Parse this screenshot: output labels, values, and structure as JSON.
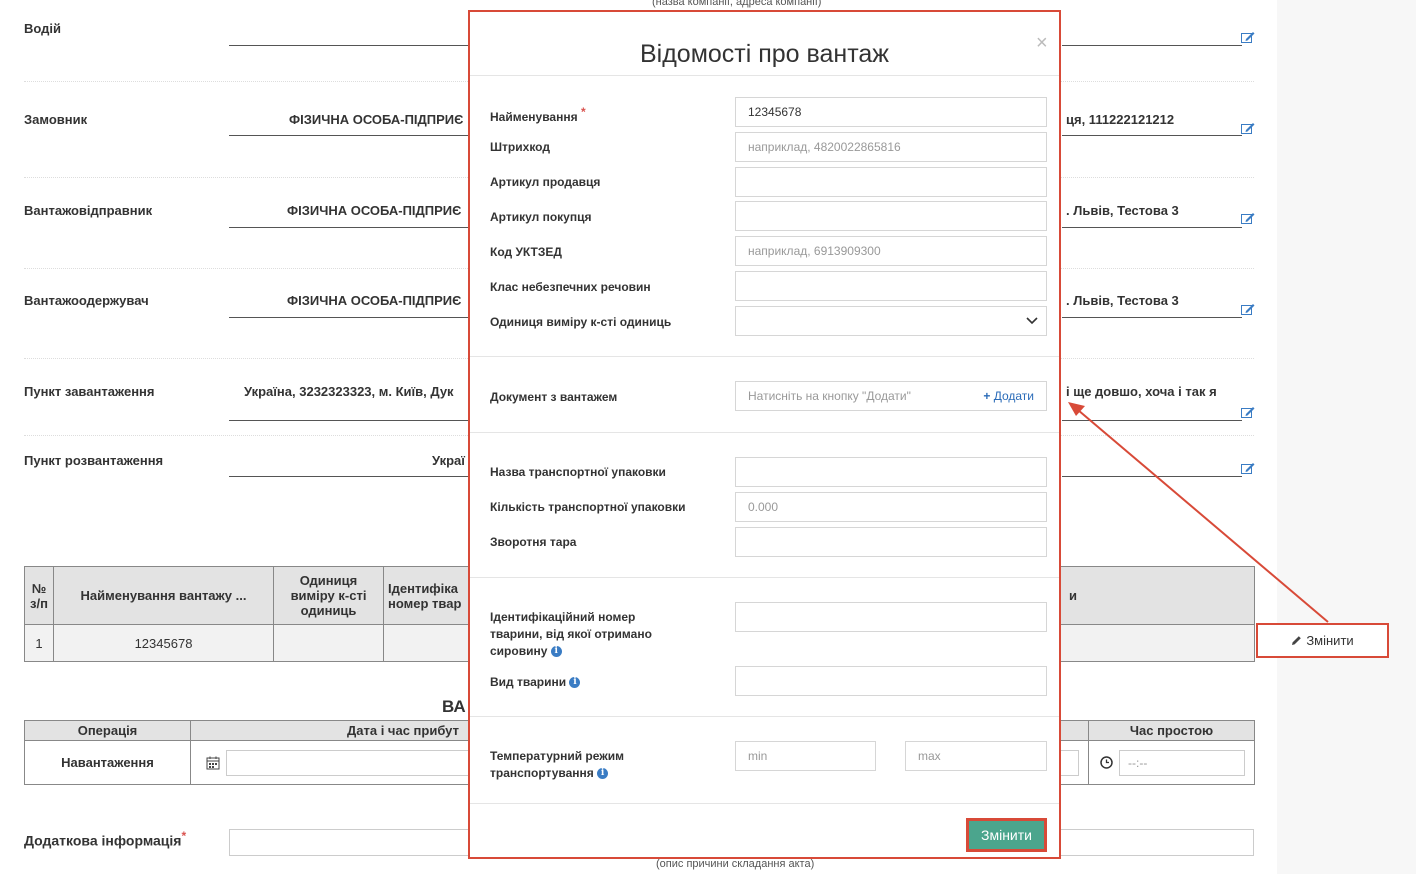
{
  "background": {
    "top_hint": "(назва компанії, адреса компанії)",
    "bottom_hint": "(опис причини складання акта)",
    "rows": [
      {
        "label": "Водій",
        "left_text": "",
        "right_text": ""
      },
      {
        "label": "Замовник",
        "left_text": "ФІЗИЧНА ОСОБА-ПІДПРИЄ",
        "right_text": "ця, 111222121212"
      },
      {
        "label": "Вантажовідправник",
        "left_text": "ФІЗИЧНА ОСОБА-ПІДПРИЄ",
        "right_text": ". Львів, Тестова 3"
      },
      {
        "label": "Вантажоодержувач",
        "left_text": "ФІЗИЧНА ОСОБА-ПІДПРИЄ",
        "right_text": ". Львів, Тестова 3"
      },
      {
        "label": "Пункт завантаження",
        "left_text": "Україна, 3232323323, м. Київ, Дук",
        "right_text": "і ще довшо, хоча і так я"
      },
      {
        "label": "Пункт розвантаження",
        "left_text": "Украї",
        "right_text": ""
      }
    ],
    "cargo_table": {
      "headers": [
        "№ з/п",
        "Найменування вантажу ...",
        "Одиниця виміру к-сті одиниць",
        "Ідентифіка номер твар",
        "и"
      ],
      "row": [
        "1",
        "12345678",
        "",
        "",
        ""
      ]
    },
    "ops_title": "ВА",
    "ops_table": {
      "headers": [
        "Операція",
        "Дата і час прибут",
        "",
        "Час простою"
      ],
      "row_label": "Навантаження",
      "time_placeholder": "--:--"
    },
    "additional_info_label": "Додаткова інформація",
    "side_button": "Змінити"
  },
  "modal": {
    "title": "Відомості про вантаж",
    "close": "×",
    "fields": {
      "name": {
        "label": "Найменування",
        "value": "12345678"
      },
      "barcode": {
        "label": "Штрихкод",
        "placeholder": "наприклад, 4820022865816"
      },
      "seller_article": {
        "label": "Артикул продавця",
        "value": ""
      },
      "buyer_article": {
        "label": "Артикул покупця",
        "value": ""
      },
      "uktzed": {
        "label": "Код УКТЗЕД",
        "placeholder": "наприклад, 6913909300"
      },
      "hazard_class": {
        "label": "Клас небезпечних речовин",
        "value": ""
      },
      "unit": {
        "label": "Одиниця виміру к-сті одиниць",
        "value": ""
      },
      "document": {
        "label": "Документ з вантажем",
        "placeholder": "Натисніть на кнопку \"Додати\"",
        "add": "Додати"
      },
      "package_name": {
        "label": "Назва транспортної упаковки",
        "value": ""
      },
      "package_qty": {
        "label": "Кількість транспортної упаковки",
        "placeholder": "0.000"
      },
      "return_tare": {
        "label": "Зворотня тара",
        "value": ""
      },
      "animal_id": {
        "label": "Ідентифікаційний номер тварини, від якої отримано сировину",
        "value": ""
      },
      "animal_kind": {
        "label": "Вид тварини",
        "value": ""
      },
      "temperature": {
        "label": "Температурний режим транспортування",
        "min_placeholder": "min",
        "max_placeholder": "max"
      }
    },
    "submit": "Змінити"
  },
  "colors": {
    "accent_red": "#d84a38",
    "submit_green": "#4ba58d",
    "info_blue": "#3a7cc4",
    "link_blue": "#2a6bb8"
  }
}
